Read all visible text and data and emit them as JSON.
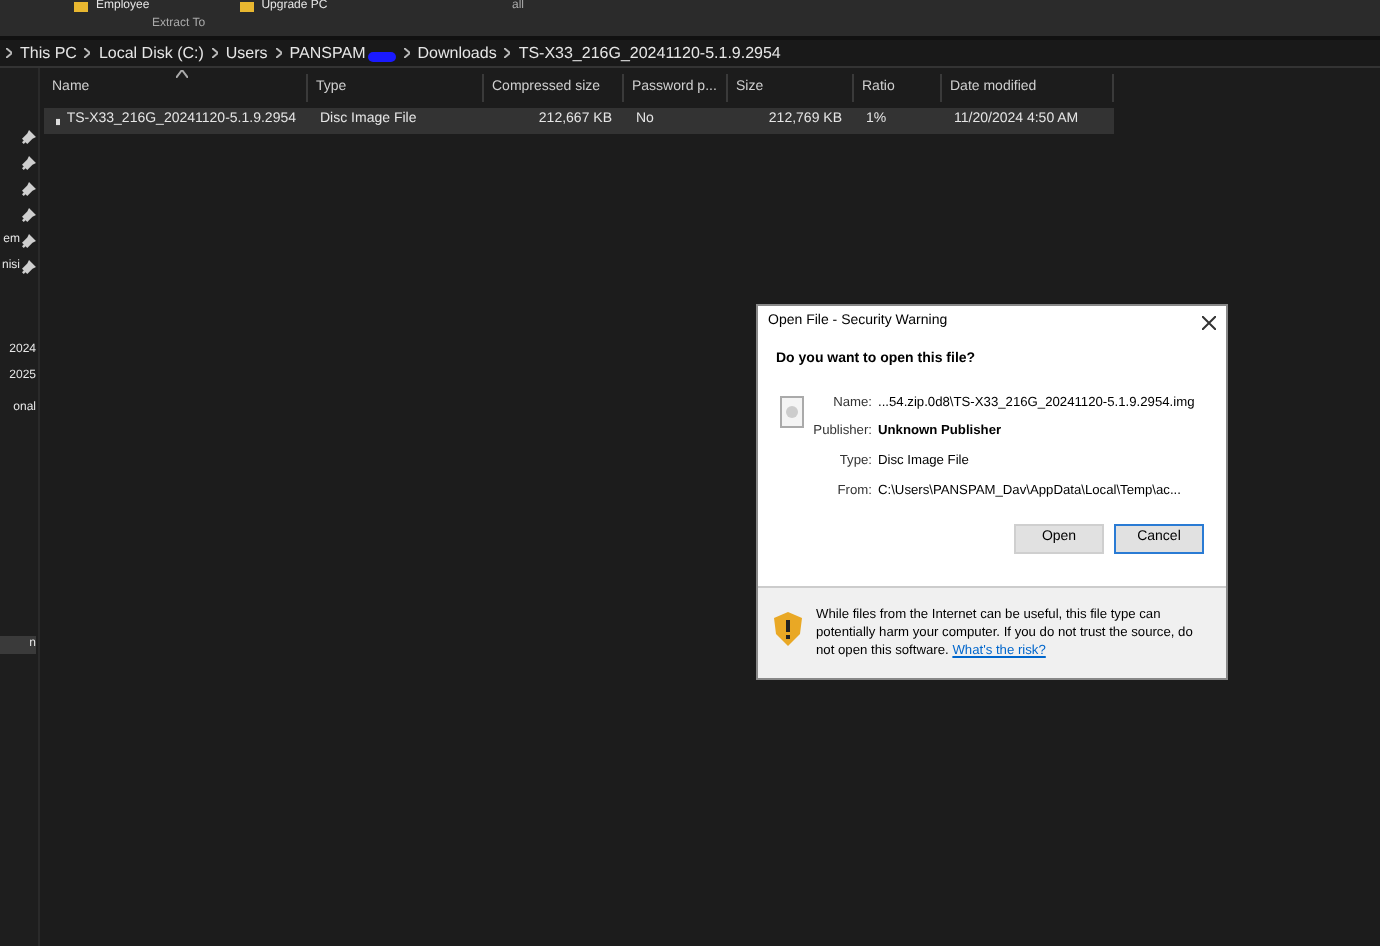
{
  "ribbon": {
    "items": [
      {
        "label": "Employee"
      },
      {
        "label": "Upgrade PC"
      }
    ],
    "group_label": "Extract To",
    "right_label": "all"
  },
  "breadcrumb": [
    {
      "label": "This PC",
      "redacted": false
    },
    {
      "label": "Local Disk (C:)",
      "redacted": false
    },
    {
      "label": "Users",
      "redacted": false
    },
    {
      "label": "PANSPAM",
      "redacted": true
    },
    {
      "label": "Downloads",
      "redacted": false
    },
    {
      "label": "TS-X33_216G_20241120-5.1.9.2954",
      "redacted": false
    }
  ],
  "sidebar": {
    "groups": [
      [
        {
          "pinned": true,
          "selected": false
        },
        {
          "pinned": true,
          "selected": false
        },
        {
          "pinned": true,
          "selected": false
        },
        {
          "pinned": true,
          "selected": false
        },
        {
          "label": "em",
          "pinned": true,
          "selected": false
        },
        {
          "label": "nisi",
          "pinned": true,
          "selected": false
        }
      ],
      [
        {
          "label": "2024",
          "pinned": false,
          "selected": false
        },
        {
          "label": "2025",
          "pinned": false,
          "selected": false
        }
      ],
      [
        {
          "label": "onal",
          "pinned": false,
          "selected": false
        }
      ],
      [
        {
          "label": "n",
          "pinned": false,
          "selected": true
        }
      ]
    ]
  },
  "table": {
    "columns": [
      "Name",
      "Type",
      "Compressed size",
      "Password p...",
      "Size",
      "Ratio",
      "Date modified"
    ],
    "rows": [
      {
        "selected": true,
        "cells": [
          "TS-X33_216G_20241120-5.1.9.2954",
          "Disc Image File",
          "212,667 KB",
          "No",
          "212,769 KB",
          "1%",
          "11/20/2024 4:50 AM"
        ]
      }
    ]
  },
  "dialog": {
    "title": "Open File - Security Warning",
    "question": "Do you want to open this file?",
    "fields": [
      {
        "label": "Name:",
        "value": "...54.zip.0d8\\TS-X33_216G_20241120-5.1.9.2954.img",
        "bold": false
      },
      {
        "label": "Publisher:",
        "value": "Unknown Publisher",
        "bold": true
      },
      {
        "label": "Type:",
        "value": "Disc Image File",
        "bold": false
      },
      {
        "label": "From:",
        "value": "C:\\Users\\PANSPAM_Dav\\AppData\\Local\\Temp\\ac...",
        "bold": false
      }
    ],
    "buttons": [
      {
        "label": "Open",
        "focused": false
      },
      {
        "label": "Cancel",
        "focused": true
      }
    ],
    "warning": "While files from the Internet can be useful, this file type can potentially harm your computer. If you do not trust the source, do not open this software.",
    "link": "What's the risk?"
  }
}
